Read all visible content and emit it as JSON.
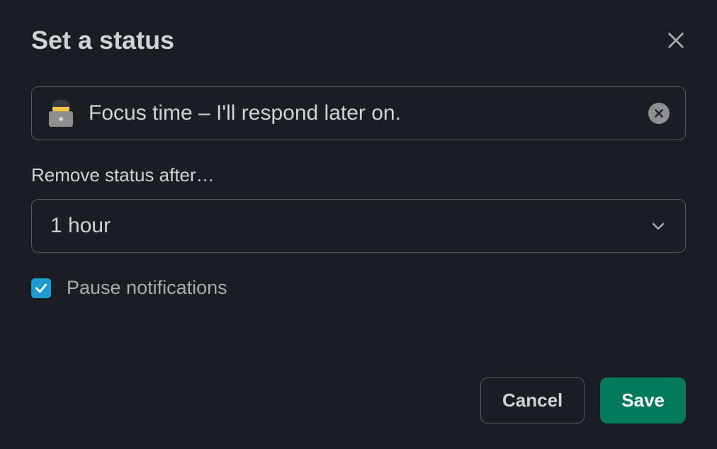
{
  "dialog": {
    "title": "Set a status",
    "status": {
      "emoji_name": "technologist-emoji",
      "text": "Focus time – I'll respond later on."
    },
    "remove_after": {
      "label": "Remove status after…",
      "value": "1 hour"
    },
    "pause_notifications": {
      "label": "Pause notifications",
      "checked": true
    },
    "buttons": {
      "cancel": "Cancel",
      "save": "Save"
    }
  }
}
